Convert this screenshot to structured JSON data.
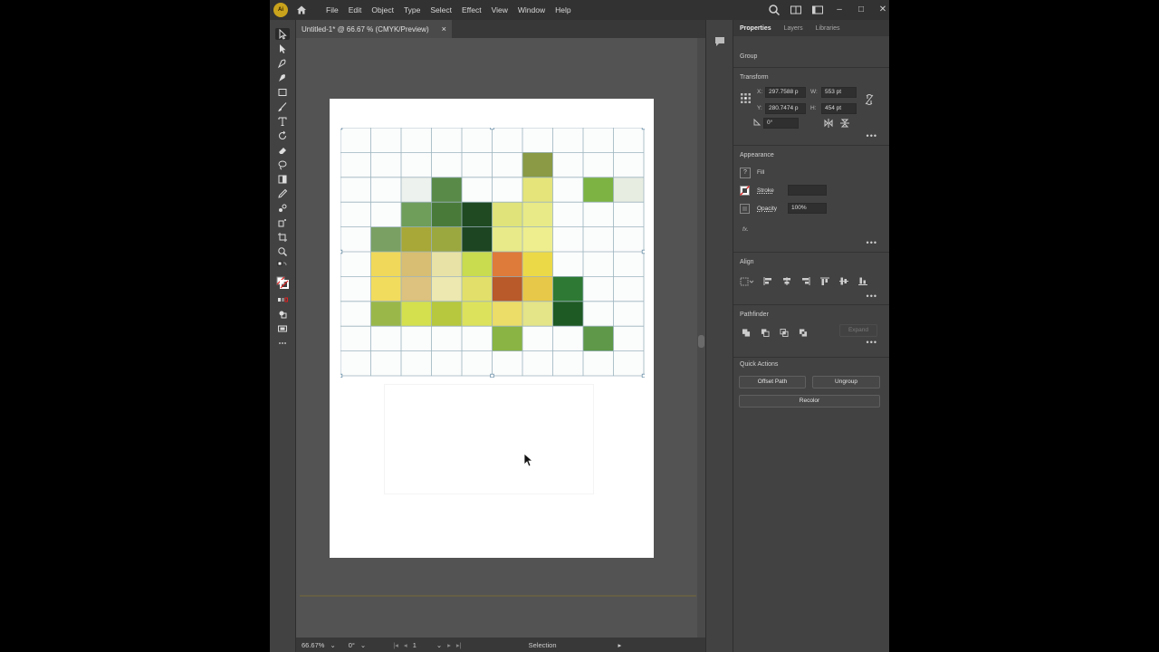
{
  "menu": {
    "logo": "Ai",
    "items": [
      "File",
      "Edit",
      "Object",
      "Type",
      "Select",
      "Effect",
      "View",
      "Window",
      "Help"
    ]
  },
  "document": {
    "tab_title": "Untitled-1* @ 66.67 % (CMYK/Preview)",
    "close_glyph": "×"
  },
  "status_bar": {
    "zoom": "66.67%",
    "rotation": "0°",
    "artboard_number": "1",
    "tool_name": "Selection"
  },
  "panel": {
    "tabs": [
      "Properties",
      "Layers",
      "Libraries"
    ],
    "selection_type": "Group",
    "transform": {
      "title": "Transform",
      "x_label": "X:",
      "x": "297.7588 p",
      "y_label": "Y:",
      "y": "280.7474 p",
      "w_label": "W:",
      "w": "553 pt",
      "h_label": "H:",
      "h": "454 pt",
      "angle": "0°"
    },
    "appearance": {
      "title": "Appearance",
      "fill_label": "Fill",
      "stroke_label": "Stroke",
      "opacity_label": "Opacity",
      "opacity": "100%",
      "fx_label": "fx."
    },
    "align": {
      "title": "Align"
    },
    "pathfinder": {
      "title": "Pathfinder",
      "expand_label": "Expand"
    },
    "quick_actions": {
      "title": "Quick Actions",
      "offset_path": "Offset Path",
      "ungroup": "Ungroup",
      "recolor": "Recolor"
    },
    "more_glyph": "•••"
  },
  "grid": {
    "cols": 10,
    "rows": 10,
    "line_color": "#9bb3bd",
    "cells": [
      {
        "r": 1,
        "c": 6,
        "color": "#8a9a45"
      },
      {
        "r": 2,
        "c": 2,
        "color": "#eef2ee"
      },
      {
        "r": 2,
        "c": 3,
        "color": "#5a8a48"
      },
      {
        "r": 2,
        "c": 6,
        "color": "#e4e47a"
      },
      {
        "r": 2,
        "c": 8,
        "color": "#7cb342"
      },
      {
        "r": 2,
        "c": 9,
        "color": "#e8ede2"
      },
      {
        "r": 3,
        "c": 2,
        "color": "#6e9e5a"
      },
      {
        "r": 3,
        "c": 3,
        "color": "#4a7a3a"
      },
      {
        "r": 3,
        "c": 4,
        "color": "#1f4a22"
      },
      {
        "r": 3,
        "c": 5,
        "color": "#dfe37a"
      },
      {
        "r": 3,
        "c": 6,
        "color": "#e8ea88"
      },
      {
        "r": 4,
        "c": 1,
        "color": "#7aa064"
      },
      {
        "r": 4,
        "c": 2,
        "color": "#a8a838"
      },
      {
        "r": 4,
        "c": 3,
        "color": "#9ba840"
      },
      {
        "r": 4,
        "c": 4,
        "color": "#1d4522"
      },
      {
        "r": 4,
        "c": 5,
        "color": "#e8ea8a"
      },
      {
        "r": 4,
        "c": 6,
        "color": "#eeee8e"
      },
      {
        "r": 5,
        "c": 1,
        "color": "#f0d95a"
      },
      {
        "r": 5,
        "c": 2,
        "color": "#d8be72"
      },
      {
        "r": 5,
        "c": 3,
        "color": "#e8e2a6"
      },
      {
        "r": 5,
        "c": 4,
        "color": "#c9db4e"
      },
      {
        "r": 5,
        "c": 5,
        "color": "#de7a3a"
      },
      {
        "r": 5,
        "c": 6,
        "color": "#ecd948"
      },
      {
        "r": 6,
        "c": 1,
        "color": "#f2dc5e"
      },
      {
        "r": 6,
        "c": 2,
        "color": "#dcc27e"
      },
      {
        "r": 6,
        "c": 3,
        "color": "#ece8b0"
      },
      {
        "r": 6,
        "c": 4,
        "color": "#e2e06a"
      },
      {
        "r": 6,
        "c": 5,
        "color": "#b85a2a"
      },
      {
        "r": 6,
        "c": 6,
        "color": "#e8c848"
      },
      {
        "r": 6,
        "c": 7,
        "color": "#2e7a34"
      },
      {
        "r": 7,
        "c": 1,
        "color": "#9ab84a"
      },
      {
        "r": 7,
        "c": 2,
        "color": "#d4e04e"
      },
      {
        "r": 7,
        "c": 3,
        "color": "#b8c83e"
      },
      {
        "r": 7,
        "c": 4,
        "color": "#dde25c"
      },
      {
        "r": 7,
        "c": 5,
        "color": "#ecdc68"
      },
      {
        "r": 7,
        "c": 6,
        "color": "#e4e488"
      },
      {
        "r": 7,
        "c": 7,
        "color": "#1e5a24"
      },
      {
        "r": 8,
        "c": 5,
        "color": "#8ab444"
      },
      {
        "r": 8,
        "c": 8,
        "color": "#5e9848"
      }
    ]
  }
}
